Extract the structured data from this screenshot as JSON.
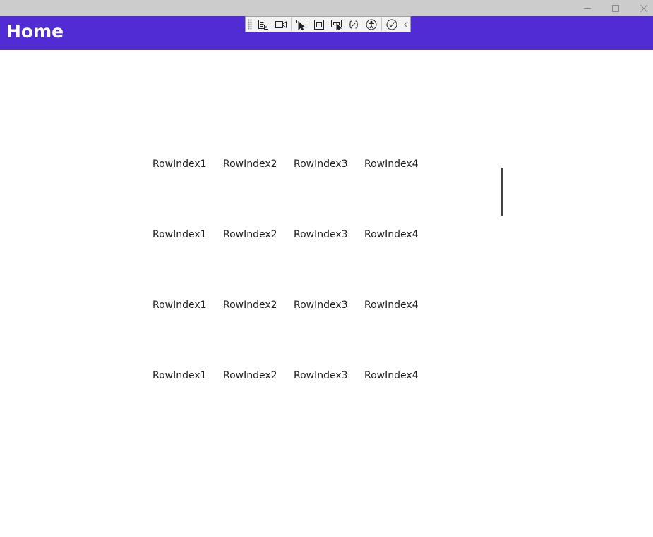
{
  "header": {
    "title": "Home"
  },
  "colors": {
    "header_bg": "#512bd4",
    "titlebar_bg": "#cccccc",
    "text": "#1f1f1f"
  },
  "window_controls": [
    "minimize-icon",
    "maximize-icon",
    "close-icon"
  ],
  "devtools_toolbar": {
    "buttons": [
      "live-visual-tree-icon",
      "record-icon",
      "select-element-icon",
      "display-layout-adorners-icon",
      "track-focused-element-icon",
      "binding-failures-icon",
      "accessibility-checker-icon",
      "hot-reload-status-icon",
      "collapse-toolbar-icon"
    ]
  },
  "grid": {
    "rows": [
      [
        "RowIndex1",
        "RowIndex2",
        "RowIndex3",
        "RowIndex4"
      ],
      [
        "RowIndex1",
        "RowIndex2",
        "RowIndex3",
        "RowIndex4"
      ],
      [
        "RowIndex1",
        "RowIndex2",
        "RowIndex3",
        "RowIndex4"
      ],
      [
        "RowIndex1",
        "RowIndex2",
        "RowIndex3",
        "RowIndex4"
      ]
    ]
  }
}
